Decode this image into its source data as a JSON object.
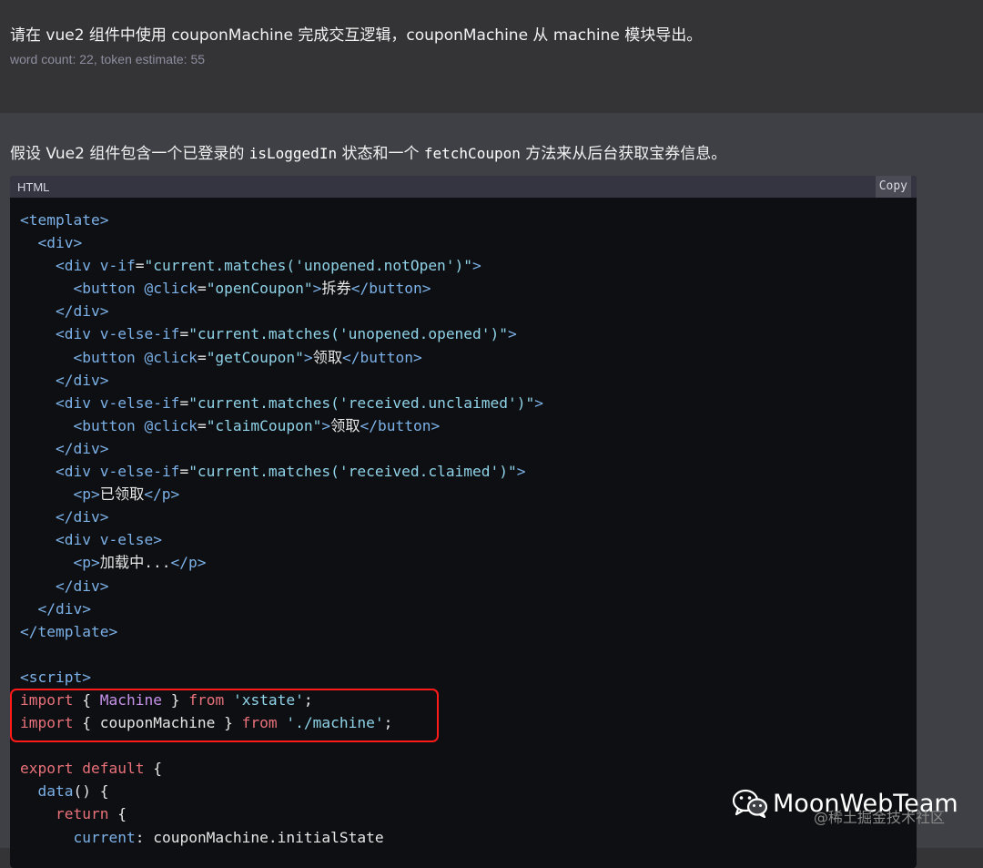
{
  "prompt": {
    "text": "请在 vue2 组件中使用 couponMachine 完成交互逻辑，couponMachine 从 machine 模块导出。",
    "meta": "word count: 22, token estimate: 55"
  },
  "answer": {
    "intro_prefix": "假设 Vue2 组件包含一个已登录的 ",
    "intro_code1": "isLoggedIn",
    "intro_mid": " 状态和一个 ",
    "intro_code2": "fetchCoupon",
    "intro_suffix": " 方法来从后台获取宝券信息。",
    "code_block": {
      "language": "HTML",
      "copy_label": "Copy",
      "lines": [
        [
          [
            "tag",
            "<template>"
          ]
        ],
        [
          [
            "plain",
            "  "
          ],
          [
            "tag",
            "<div>"
          ]
        ],
        [
          [
            "plain",
            "    "
          ],
          [
            "tag",
            "<div "
          ],
          [
            "attr",
            "v-if"
          ],
          [
            "punct",
            "="
          ],
          [
            "str",
            "\"current.matches('unopened.notOpen')\""
          ],
          [
            "tag",
            ">"
          ]
        ],
        [
          [
            "plain",
            "      "
          ],
          [
            "tag",
            "<button "
          ],
          [
            "attr",
            "@click"
          ],
          [
            "punct",
            "="
          ],
          [
            "str",
            "\"openCoupon\""
          ],
          [
            "tag",
            ">"
          ],
          [
            "plain",
            "拆券"
          ],
          [
            "tag",
            "</button>"
          ]
        ],
        [
          [
            "plain",
            "    "
          ],
          [
            "tag",
            "</div>"
          ]
        ],
        [
          [
            "plain",
            "    "
          ],
          [
            "tag",
            "<div "
          ],
          [
            "attr",
            "v-else-if"
          ],
          [
            "punct",
            "="
          ],
          [
            "str",
            "\"current.matches('unopened.opened')\""
          ],
          [
            "tag",
            ">"
          ]
        ],
        [
          [
            "plain",
            "      "
          ],
          [
            "tag",
            "<button "
          ],
          [
            "attr",
            "@click"
          ],
          [
            "punct",
            "="
          ],
          [
            "str",
            "\"getCoupon\""
          ],
          [
            "tag",
            ">"
          ],
          [
            "plain",
            "领取"
          ],
          [
            "tag",
            "</button>"
          ]
        ],
        [
          [
            "plain",
            "    "
          ],
          [
            "tag",
            "</div>"
          ]
        ],
        [
          [
            "plain",
            "    "
          ],
          [
            "tag",
            "<div "
          ],
          [
            "attr",
            "v-else-if"
          ],
          [
            "punct",
            "="
          ],
          [
            "str",
            "\"current.matches('received.unclaimed')\""
          ],
          [
            "tag",
            ">"
          ]
        ],
        [
          [
            "plain",
            "      "
          ],
          [
            "tag",
            "<button "
          ],
          [
            "attr",
            "@click"
          ],
          [
            "punct",
            "="
          ],
          [
            "str",
            "\"claimCoupon\""
          ],
          [
            "tag",
            ">"
          ],
          [
            "plain",
            "领取"
          ],
          [
            "tag",
            "</button>"
          ]
        ],
        [
          [
            "plain",
            "    "
          ],
          [
            "tag",
            "</div>"
          ]
        ],
        [
          [
            "plain",
            "    "
          ],
          [
            "tag",
            "<div "
          ],
          [
            "attr",
            "v-else-if"
          ],
          [
            "punct",
            "="
          ],
          [
            "str",
            "\"current.matches('received.claimed')\""
          ],
          [
            "tag",
            ">"
          ]
        ],
        [
          [
            "plain",
            "      "
          ],
          [
            "tag",
            "<p>"
          ],
          [
            "plain",
            "已领取"
          ],
          [
            "tag",
            "</p>"
          ]
        ],
        [
          [
            "plain",
            "    "
          ],
          [
            "tag",
            "</div>"
          ]
        ],
        [
          [
            "plain",
            "    "
          ],
          [
            "tag",
            "<div "
          ],
          [
            "attr",
            "v-else"
          ],
          [
            "tag",
            ">"
          ]
        ],
        [
          [
            "plain",
            "      "
          ],
          [
            "tag",
            "<p>"
          ],
          [
            "plain",
            "加载中..."
          ],
          [
            "tag",
            "</p>"
          ]
        ],
        [
          [
            "plain",
            "    "
          ],
          [
            "tag",
            "</div>"
          ]
        ],
        [
          [
            "plain",
            "  "
          ],
          [
            "tag",
            "</div>"
          ]
        ],
        [
          [
            "tag",
            "</template>"
          ]
        ],
        [
          [
            "plain",
            ""
          ]
        ],
        [
          [
            "tag",
            "<script>"
          ]
        ],
        [
          [
            "kw",
            "import"
          ],
          [
            "plain",
            " { "
          ],
          [
            "cls",
            "Machine"
          ],
          [
            "plain",
            " } "
          ],
          [
            "kw",
            "from"
          ],
          [
            "plain",
            " "
          ],
          [
            "str",
            "'xstate'"
          ],
          [
            "plain",
            ";"
          ]
        ],
        [
          [
            "kw",
            "import"
          ],
          [
            "plain",
            " { couponMachine } "
          ],
          [
            "kw",
            "from"
          ],
          [
            "plain",
            " "
          ],
          [
            "str",
            "'./machine'"
          ],
          [
            "plain",
            ";"
          ]
        ],
        [
          [
            "plain",
            ""
          ]
        ],
        [
          [
            "kw",
            "export"
          ],
          [
            "plain",
            " "
          ],
          [
            "kw",
            "default"
          ],
          [
            "plain",
            " {"
          ]
        ],
        [
          [
            "plain",
            "  "
          ],
          [
            "prop",
            "data"
          ],
          [
            "plain",
            "() {"
          ]
        ],
        [
          [
            "plain",
            "    "
          ],
          [
            "kw",
            "return"
          ],
          [
            "plain",
            " {"
          ]
        ],
        [
          [
            "plain",
            "      "
          ],
          [
            "prop",
            "current"
          ],
          [
            "plain",
            ": couponMachine.initialState"
          ]
        ]
      ]
    }
  },
  "watermark": {
    "icon": "wechat-icon",
    "text": "MoonWebTeam",
    "subtext": "@稀土掘金技术社区"
  },
  "colors": {
    "highlight_border": "#ff1a1a",
    "code_bg": "#0e0f12"
  }
}
